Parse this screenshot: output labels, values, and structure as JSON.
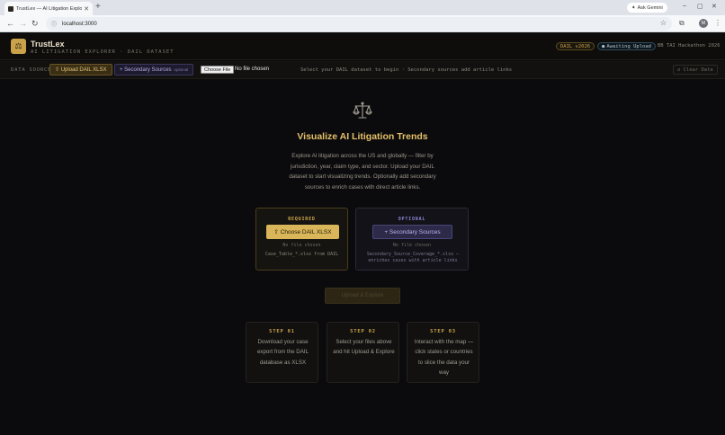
{
  "browser": {
    "tab_title": "TrustLex — AI Litigation Explor...",
    "url": "localhost:3000",
    "gemini_label": "Ask Gemini",
    "avatar_letter": "M"
  },
  "header": {
    "brand": "TrustLex",
    "tagline": "AI LITIGATION EXPLORER · DAIL DATASET",
    "version_badge": "DAIL v2026",
    "status_badge": "Awaiting Upload",
    "event": "BB TAI Hackathon 2026"
  },
  "source_bar": {
    "label": "DATA SOURCE",
    "upload_label": "⇧ Upload DAIL XLSX",
    "secondary_label": "+ Secondary Sources",
    "secondary_optional": "optional",
    "file_button": "Choose File",
    "file_status": "No file chosen",
    "hint": "Select your DAIL dataset to begin · Secondary sources add article links",
    "clear_label": "↺ Clear Data"
  },
  "main": {
    "title": "Visualize AI Litigation Trends",
    "description": "Explore AI litigation across the US and globally — filter by jurisdiction, year, claim type, and sector. Upload your DAIL dataset to start visualizing trends. Optionally add secondary sources to enrich cases with direct article links.",
    "required_card": {
      "label": "REQUIRED",
      "button": "⇧ Choose DAIL XLSX",
      "status": "No file chosen",
      "hint": "Case_Table_*.xlsx from DAIL"
    },
    "optional_card": {
      "label": "OPTIONAL",
      "button": "+ Secondary Sources",
      "status": "No file chosen",
      "hint": "Secondary_Source_Coverage_*.xlsx — enriches cases with article links"
    },
    "explore_button": "Upload & Explore",
    "steps": [
      {
        "num": "STEP 01",
        "text": "Download your case export from the DAIL database as XLSX"
      },
      {
        "num": "STEP 02",
        "text": "Select your files above and hit Upload & Explore"
      },
      {
        "num": "STEP 03",
        "text": "Interact with the map — click states or countries to slice the data your way"
      }
    ]
  },
  "colors": {
    "accent_gold": "#d9b65a",
    "accent_purple": "#8e87d6",
    "background": "#0b0b0d"
  }
}
